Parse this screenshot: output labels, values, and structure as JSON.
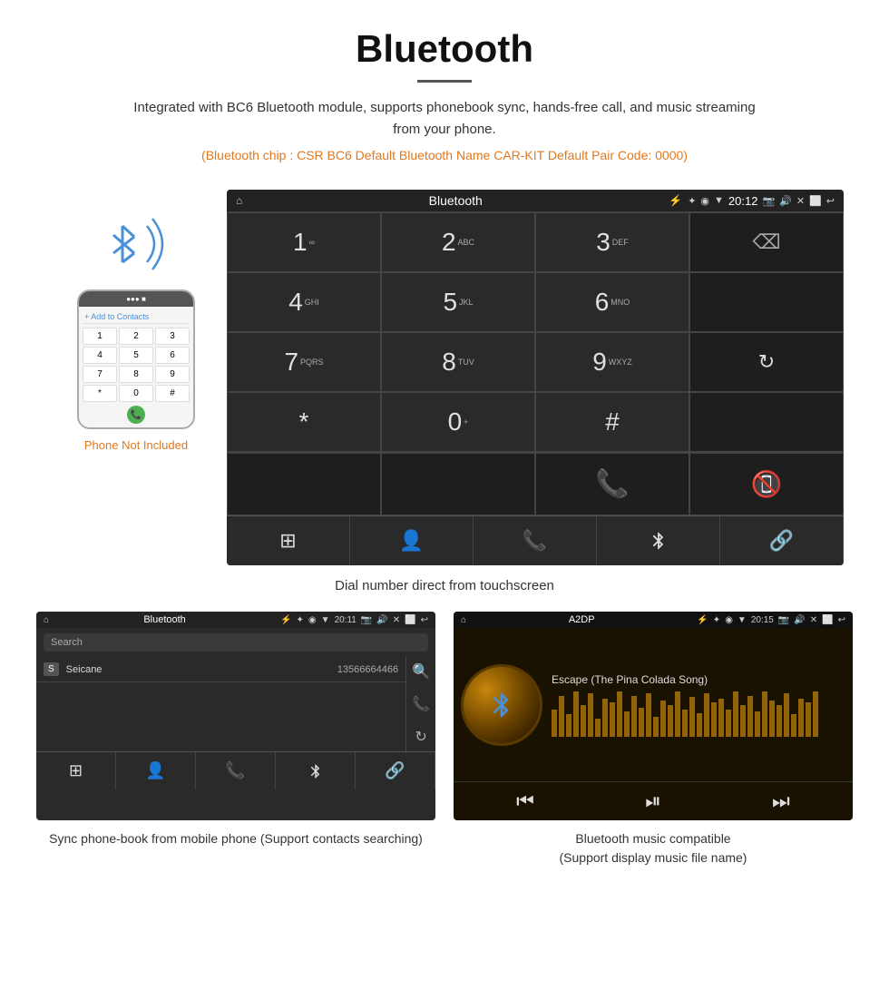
{
  "header": {
    "title": "Bluetooth",
    "subtitle": "Integrated with BC6 Bluetooth module, supports phonebook sync, hands-free call, and music streaming from your phone.",
    "chip_info": "(Bluetooth chip : CSR BC6    Default Bluetooth Name CAR-KIT    Default Pair Code: 0000)"
  },
  "phone_label": "Phone Not Included",
  "dial_screen": {
    "title": "Bluetooth",
    "time": "20:12",
    "keys": [
      {
        "main": "1",
        "sub": "∞"
      },
      {
        "main": "2",
        "sub": "ABC"
      },
      {
        "main": "3",
        "sub": "DEF"
      },
      {
        "main": "",
        "sub": ""
      },
      {
        "main": "4",
        "sub": "GHI"
      },
      {
        "main": "5",
        "sub": "JKL"
      },
      {
        "main": "6",
        "sub": "MNO"
      },
      {
        "main": "",
        "sub": ""
      },
      {
        "main": "7",
        "sub": "PQRS"
      },
      {
        "main": "8",
        "sub": "TUV"
      },
      {
        "main": "9",
        "sub": "WXYZ"
      },
      {
        "main": "",
        "sub": ""
      },
      {
        "main": "*",
        "sub": ""
      },
      {
        "main": "0",
        "sub": "+"
      },
      {
        "main": "#",
        "sub": ""
      },
      {
        "main": "",
        "sub": ""
      }
    ]
  },
  "dial_caption": "Dial number direct from touchscreen",
  "phonebook_screen": {
    "title": "Bluetooth",
    "time": "20:11",
    "search_placeholder": "Search",
    "contact": {
      "letter": "S",
      "name": "Seicane",
      "phone": "13566664466"
    }
  },
  "phonebook_caption": "Sync phone-book from mobile phone\n(Support contacts searching)",
  "music_screen": {
    "title": "A2DP",
    "time": "20:15",
    "song_title": "Escape (The Pina Colada Song)"
  },
  "music_caption": "Bluetooth music compatible\n(Support display music file name)",
  "viz_bars": [
    30,
    45,
    25,
    50,
    35,
    48,
    20,
    42,
    38,
    50,
    28,
    45,
    32,
    48,
    22,
    40,
    35,
    50,
    30,
    44,
    26,
    48,
    38,
    42,
    30,
    50,
    35,
    45,
    28,
    50,
    40,
    35,
    48,
    25,
    42,
    38,
    50
  ]
}
